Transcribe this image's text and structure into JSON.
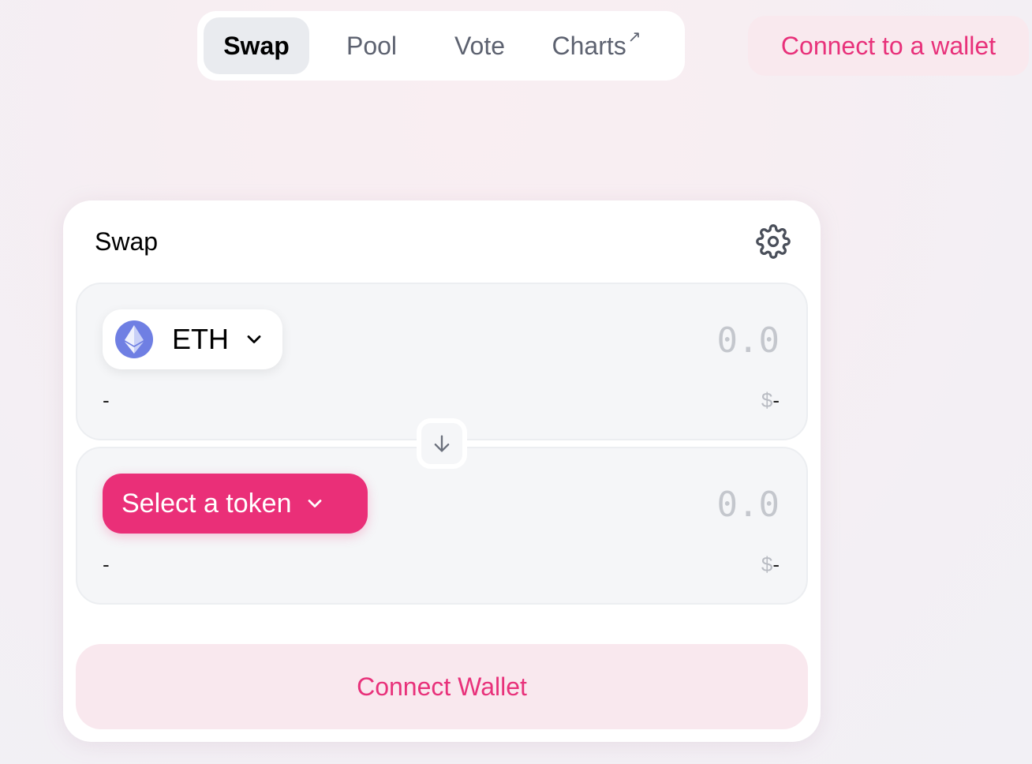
{
  "nav": {
    "tabs": [
      {
        "label": "Swap",
        "active": true
      },
      {
        "label": "Pool",
        "active": false
      },
      {
        "label": "Vote",
        "active": false
      },
      {
        "label": "Charts",
        "active": false,
        "external_icon": "arrow-up-right-icon"
      }
    ],
    "charts_arrow": "↗"
  },
  "header": {
    "connect_label": "Connect to a wallet"
  },
  "swap": {
    "title": "Swap",
    "settings_icon": "gear-icon",
    "input": {
      "token": "ETH",
      "amount_placeholder": "0.0",
      "balance": "-",
      "usd_symbol": "$",
      "usd_value": "-"
    },
    "output": {
      "token_select_label": "Select a token",
      "amount_placeholder": "0.0",
      "balance": "-",
      "usd_symbol": "$",
      "usd_value": "-"
    },
    "switch_icon": "arrow-down-icon",
    "connect_button": "Connect Wallet"
  },
  "colors": {
    "accent": "#e8317a",
    "accent_bg": "#f9e8ee",
    "eth": "#6f7fe3"
  }
}
